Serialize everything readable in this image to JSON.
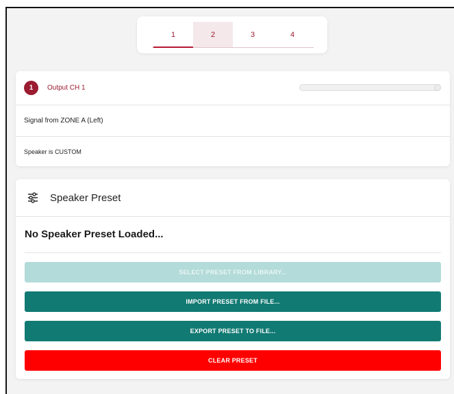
{
  "tabs": [
    "1",
    "2",
    "3",
    "4"
  ],
  "output": {
    "badge": "1",
    "title": "Output CH 1",
    "signal": "Signal from ZONE A (Left)",
    "speaker": "Speaker is CUSTOM",
    "slider_level": 1.0
  },
  "preset": {
    "title": "Speaker Preset",
    "icon": "tune-icon",
    "status": "No Speaker Preset Loaded...",
    "select_label": "SELECT PRESET FROM LIBRARY...",
    "import_label": "IMPORT PRESET FROM FILE...",
    "export_label": "EXPORT PRESET TO FILE...",
    "clear_label": "CLEAR PRESET"
  },
  "colors": {
    "accent": "#9b1b30",
    "teal": "#117a73",
    "teal_disabled": "#b2dbd9",
    "danger": "#ff0000"
  }
}
